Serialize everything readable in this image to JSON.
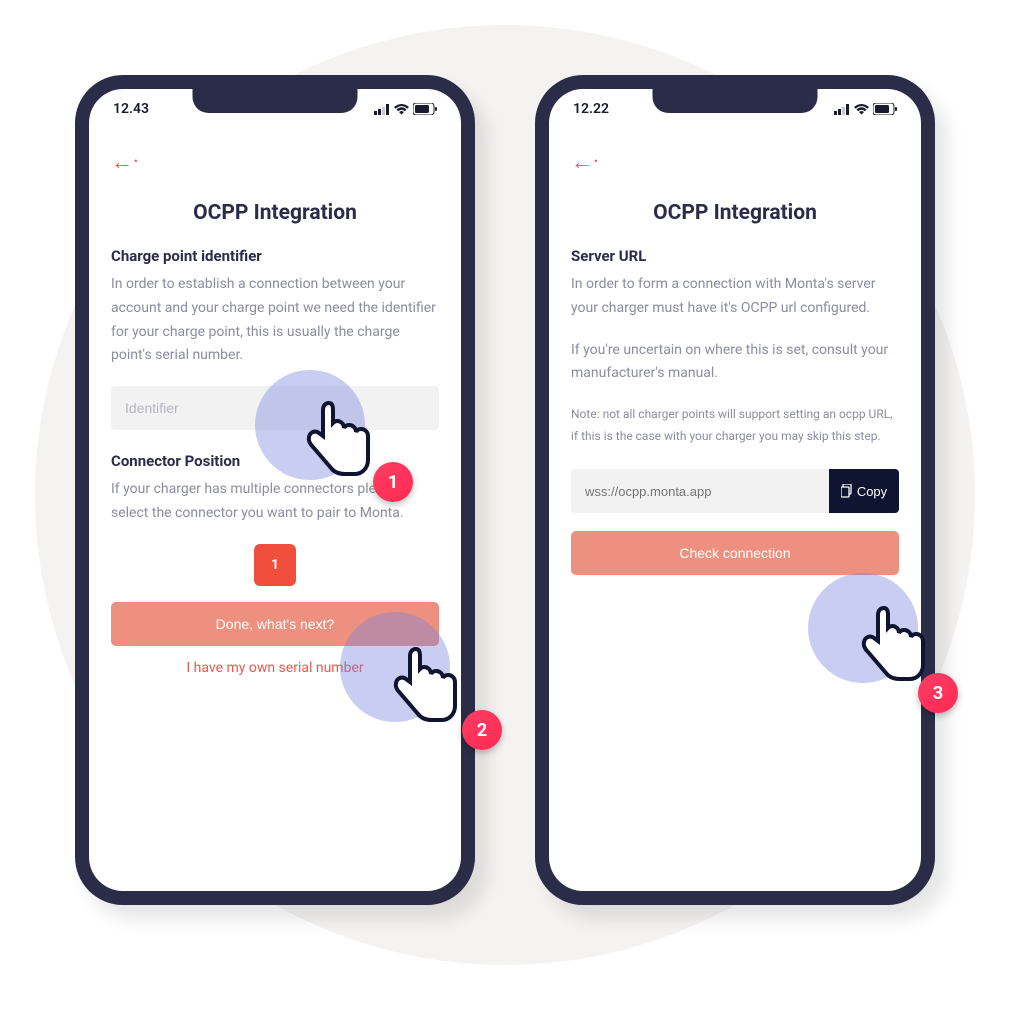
{
  "phone1": {
    "status_time": "12.43",
    "title": "OCPP Integration",
    "section1_heading": "Charge point identifier",
    "section1_body": "In order to establish a connection between your account and your charge point we need the identifier for your charge point, this is usually the charge point's serial number.",
    "identifier_placeholder": "Identifier",
    "section2_heading": "Connector Position",
    "section2_body": "If your charger has multiple connectors please select the connector you want to pair to Monta.",
    "connector_badge": "1",
    "done_button": "Done, what's next?",
    "serial_link": "I have my own serial number"
  },
  "phone2": {
    "status_time": "12.22",
    "title": "OCPP Integration",
    "section1_heading": "Server URL",
    "section1_body": "In order to form a connection with Monta's server your charger must have it's OCPP url configured.",
    "section1_body2": "If you're uncertain on where this is set, consult your manufacturer's manual.",
    "note": "Note: not all charger points will support setting an ocpp URL, if this is the case with your charger you may skip this step.",
    "url_placeholder": "wss://ocpp.monta.app",
    "copy_label": "Copy",
    "check_button": "Check connection"
  },
  "callouts": {
    "c1": "1",
    "c2": "2",
    "c3": "3"
  },
  "colors": {
    "phone_frame": "#2b2c48",
    "accent": "#e85a4f",
    "primary_btn": "#ed907f",
    "badge": "#ff2a53",
    "dark_btn": "#0f1430"
  }
}
